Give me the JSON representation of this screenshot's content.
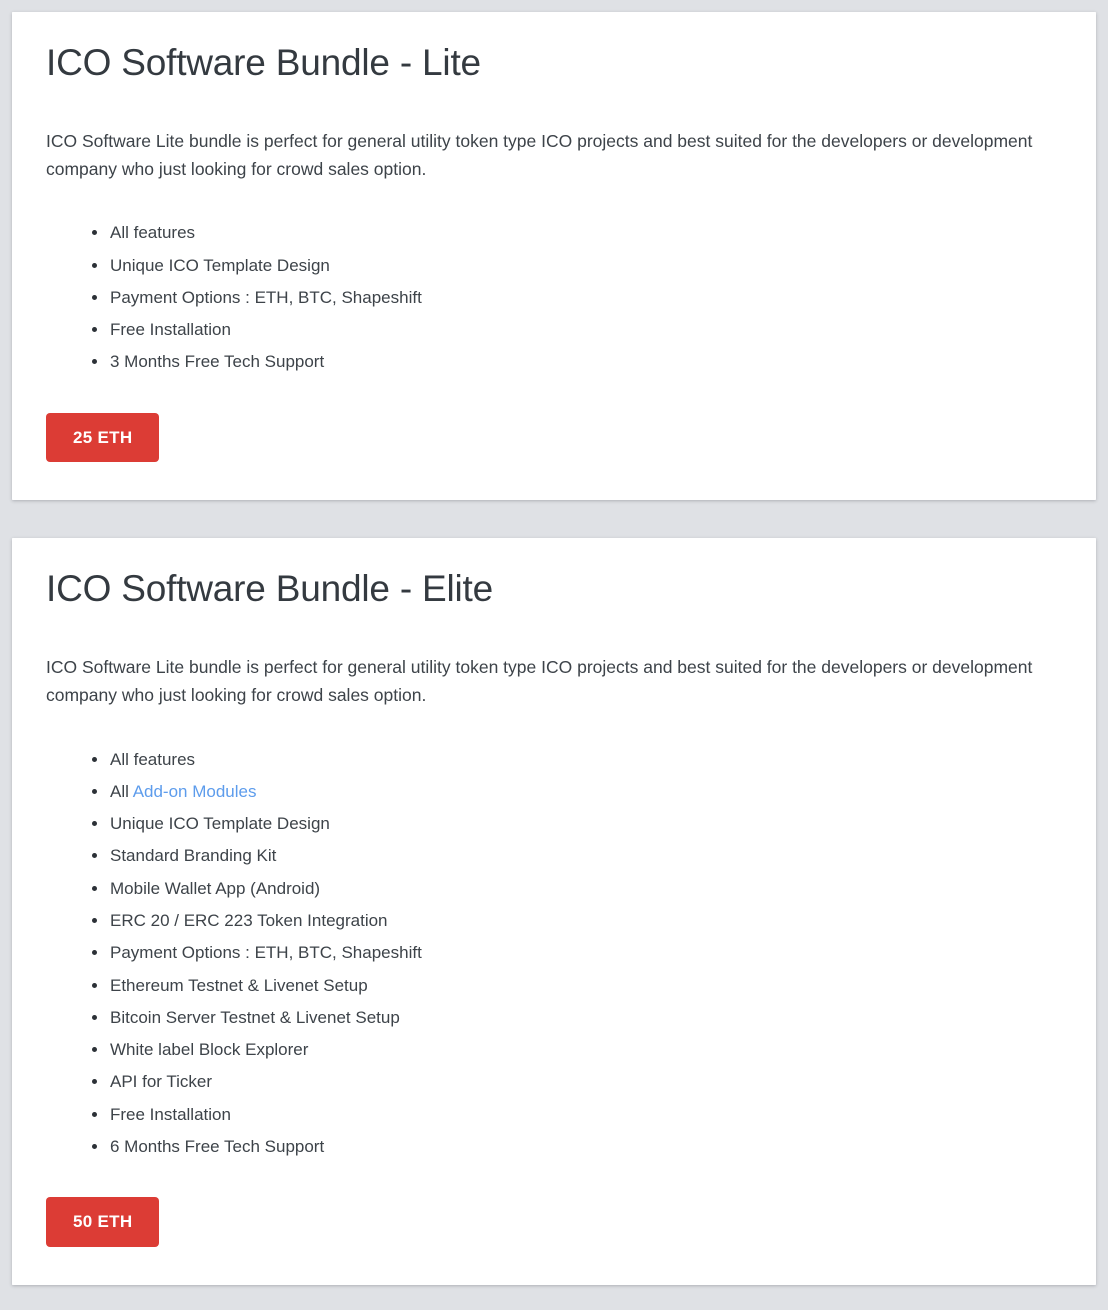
{
  "page": {
    "background_color": "#dfe1e5",
    "card_background_color": "#ffffff",
    "accent_color": "#dc3c35",
    "link_color": "#5d9cec",
    "heading_color": "#343a40",
    "body_text_color": "#3d4349"
  },
  "cards": [
    {
      "title": "ICO Software Bundle - Lite",
      "description": "ICO Software Lite bundle is perfect for general utility token type ICO projects and best suited for the developers or development company who just looking for crowd sales option.",
      "features": [
        {
          "text": "All features"
        },
        {
          "text": "Unique ICO Template Design"
        },
        {
          "text": "Payment Options : ETH, BTC, Shapeshift"
        },
        {
          "text": "Free Installation"
        },
        {
          "text": "3 Months Free Tech Support"
        }
      ],
      "price_label": "25 ETH"
    },
    {
      "title": "ICO Software Bundle - Elite",
      "description": "ICO Software Lite bundle is perfect for general utility token type ICO projects and best suited for the developers or development company who just looking for crowd sales option.",
      "features": [
        {
          "text": "All features"
        },
        {
          "prefix": "All ",
          "link_text": "Add-on Modules"
        },
        {
          "text": "Unique ICO Template Design"
        },
        {
          "text": "Standard Branding Kit"
        },
        {
          "text": "Mobile Wallet App (Android)"
        },
        {
          "text": "ERC 20 / ERC 223 Token Integration"
        },
        {
          "text": "Payment Options : ETH, BTC, Shapeshift"
        },
        {
          "text": "Ethereum Testnet & Livenet Setup"
        },
        {
          "text": "Bitcoin Server Testnet & Livenet Setup"
        },
        {
          "text": "White label Block Explorer"
        },
        {
          "text": "API for Ticker"
        },
        {
          "text": "Free Installation"
        },
        {
          "text": "6 Months Free Tech Support"
        }
      ],
      "price_label": "50 ETH"
    }
  ]
}
